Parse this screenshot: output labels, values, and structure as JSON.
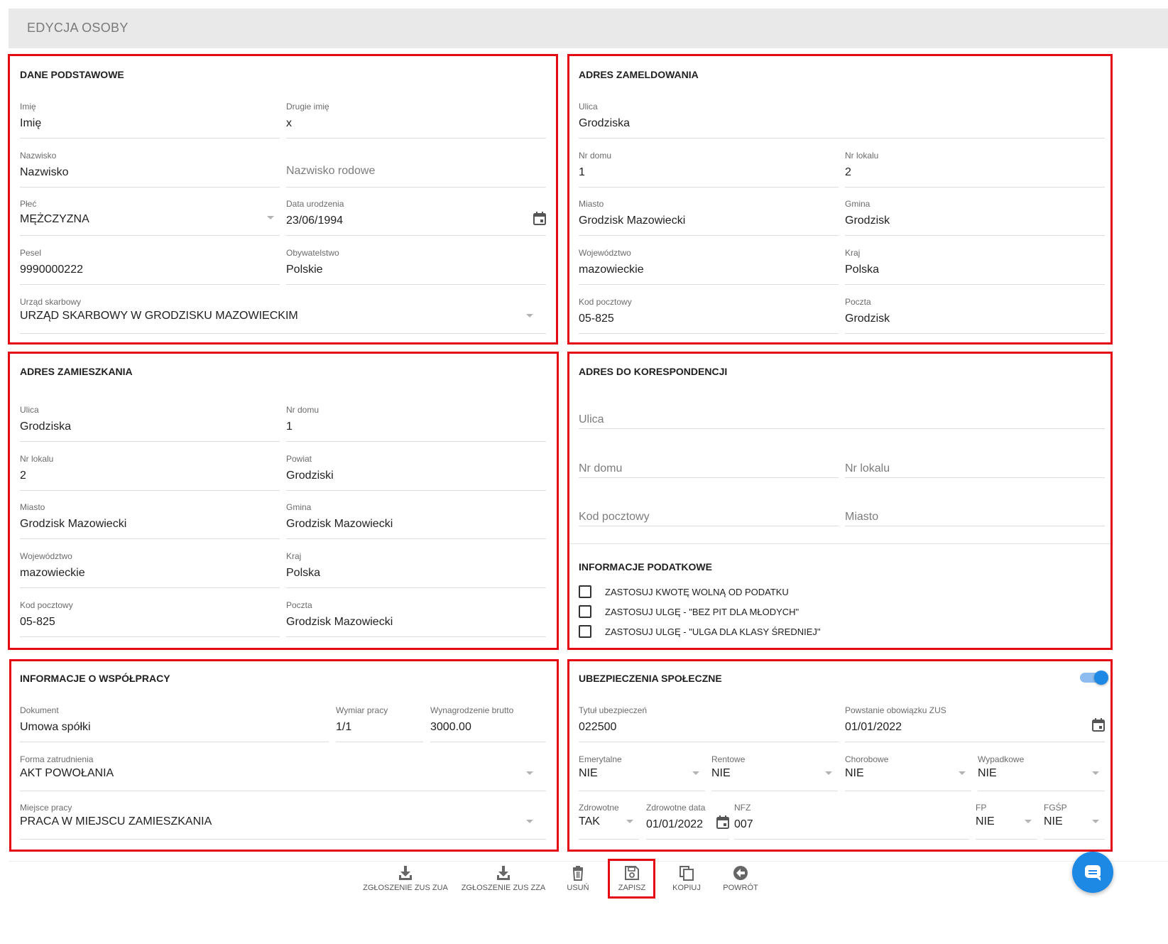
{
  "page": {
    "title": "EDYCJA OSOBY"
  },
  "dane_podstawowe": {
    "title": "DANE PODSTAWOWE",
    "imie_label": "Imię",
    "imie_value": "Imię",
    "drugie_imie_label": "Drugie imię",
    "drugie_imie_value": "x",
    "nazwisko_label": "Nazwisko",
    "nazwisko_value": "Nazwisko",
    "nazwisko_rodowe_placeholder": "Nazwisko rodowe",
    "plec_label": "Płeć",
    "plec_value": "MĘŻCZYZNA",
    "data_urodzenia_label": "Data urodzenia",
    "data_urodzenia_value": "23/06/1994",
    "pesel_label": "Pesel",
    "pesel_value": "9990000222",
    "obywatelstwo_label": "Obywatelstwo",
    "obywatelstwo_value": "Polskie",
    "urzad_label": "Urząd skarbowy",
    "urzad_value": "URZĄD SKARBOWY W GRODZISKU MAZOWIECKIM"
  },
  "adres_zameldowania": {
    "title": "ADRES ZAMELDOWANIA",
    "ulica_label": "Ulica",
    "ulica_value": "Grodziska",
    "nr_domu_label": "Nr domu",
    "nr_domu_value": "1",
    "nr_lokalu_label": "Nr lokalu",
    "nr_lokalu_value": "2",
    "miasto_label": "Miasto",
    "miasto_value": "Grodzisk Mazowiecki",
    "gmina_label": "Gmina",
    "gmina_value": "Grodzisk",
    "wojewodztwo_label": "Województwo",
    "wojewodztwo_value": "mazowieckie",
    "kraj_label": "Kraj",
    "kraj_value": "Polska",
    "kod_label": "Kod pocztowy",
    "kod_value": "05-825",
    "poczta_label": "Poczta",
    "poczta_value": "Grodzisk"
  },
  "adres_zamieszkania": {
    "title": "ADRES ZAMIESZKANIA",
    "ulica_label": "Ulica",
    "ulica_value": "Grodziska",
    "nr_domu_label": "Nr domu",
    "nr_domu_value": "1",
    "nr_lokalu_label": "Nr lokalu",
    "nr_lokalu_value": "2",
    "powiat_label": "Powiat",
    "powiat_value": "Grodziski",
    "miasto_label": "Miasto",
    "miasto_value": "Grodzisk Mazowiecki",
    "gmina_label": "Gmina",
    "gmina_value": "Grodzisk Mazowiecki",
    "wojewodztwo_label": "Województwo",
    "wojewodztwo_value": "mazowieckie",
    "kraj_label": "Kraj",
    "kraj_value": "Polska",
    "kod_label": "Kod pocztowy",
    "kod_value": "05-825",
    "poczta_label": "Poczta",
    "poczta_value": "Grodzisk Mazowiecki"
  },
  "adres_korespondencji": {
    "title": "ADRES DO KORESPONDENCJI",
    "ulica_placeholder": "Ulica",
    "nr_domu_placeholder": "Nr domu",
    "nr_lokalu_placeholder": "Nr lokalu",
    "kod_placeholder": "Kod pocztowy",
    "miasto_placeholder": "Miasto"
  },
  "informacje_podatkowe": {
    "title": "INFORMACJE PODATKOWE",
    "options": [
      {
        "label": "ZASTOSUJ KWOTĘ WOLNĄ OD PODATKU",
        "checked": false
      },
      {
        "label": "ZASTOSUJ ULGĘ - \"BEZ PIT DLA MŁODYCH\"",
        "checked": false
      },
      {
        "label": "ZASTOSUJ ULGĘ - \"ULGA DLA KLASY ŚREDNIEJ\"",
        "checked": false
      }
    ]
  },
  "wspolpraca": {
    "title": "INFORMACJE O WSPÓŁPRACY",
    "dokument_label": "Dokument",
    "dokument_value": "Umowa spółki",
    "wymiar_label": "Wymiar pracy",
    "wymiar_value": "1/1",
    "wynagrodzenie_label": "Wynagrodzenie brutto",
    "wynagrodzenie_value": "3000.00",
    "forma_label": "Forma zatrudnienia",
    "forma_value": "AKT POWOŁANIA",
    "miejsce_label": "Miejsce pracy",
    "miejsce_value": "PRACA W MIEJSCU ZAMIESZKANIA"
  },
  "ubezpieczenia": {
    "title": "UBEZPIECZENIA SPOŁECZNE",
    "toggle_on": true,
    "tytul_label": "Tytuł ubezpieczeń",
    "tytul_value": "022500",
    "powstanie_label": "Powstanie obowiązku ZUS",
    "powstanie_value": "01/01/2022",
    "emerytalne_label": "Emerytalne",
    "emerytalne_value": "NIE",
    "rentowe_label": "Rentowe",
    "rentowe_value": "NIE",
    "chorobowe_label": "Chorobowe",
    "chorobowe_value": "NIE",
    "wypadkowe_label": "Wypadkowe",
    "wypadkowe_value": "NIE",
    "zdrowotne_label": "Zdrowotne",
    "zdrowotne_value": "TAK",
    "zdrowotne_data_label": "Zdrowotne data",
    "zdrowotne_data_value": "01/01/2022",
    "nfz_label": "NFZ",
    "nfz_value": "007",
    "fp_label": "FP",
    "fp_value": "NIE",
    "fgsp_label": "FGŚP",
    "fgsp_value": "NIE"
  },
  "toolbar": {
    "zua_label": "ZGŁOSZENIE ZUS ZUA",
    "zza_label": "ZGŁOSZENIE ZUS ZZA",
    "usun_label": "USUŃ",
    "zapisz_label": "ZAPISZ",
    "kopiuj_label": "KOPIUJ",
    "powrot_label": "POWRÓT"
  },
  "colors": {
    "highlight": "#e50914",
    "accent": "#1e88e5",
    "header_bg": "#e9e9e9"
  }
}
